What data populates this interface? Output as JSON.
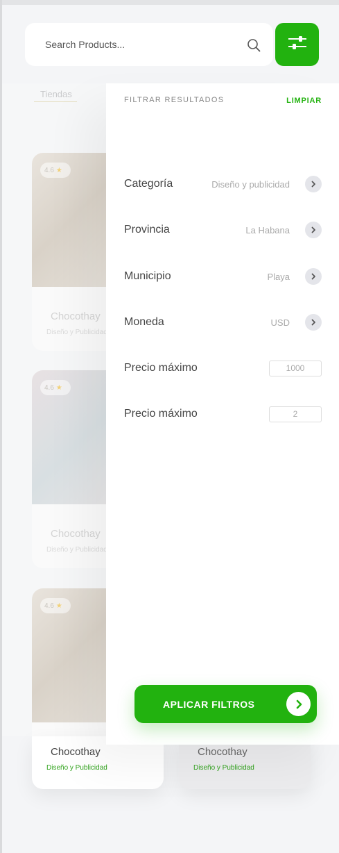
{
  "search": {
    "placeholder": "Search Products..."
  },
  "tabs": {
    "active_label": "Tiendas"
  },
  "cards": [
    {
      "rating": "4.6",
      "title": "Chocothay",
      "category": "Diseño y Publicidad"
    },
    {
      "rating": "4.6",
      "title": "Chocothay",
      "category": "Diseño y Publicidad"
    },
    {
      "rating": "4.6",
      "title": "Chocothay",
      "category": "Diseño y Publicidad"
    }
  ],
  "bottom_cards": [
    {
      "title": "Chocothay",
      "category": "Diseño y Publicidad"
    },
    {
      "title": "Chocothay",
      "category": "Diseño y Publicidad"
    }
  ],
  "filter_panel": {
    "heading": "FILTRAR RESULTADOS",
    "clear_label": "LIMPIAR",
    "rows": [
      {
        "label": "Categoría",
        "value": "Diseño y publicidad"
      },
      {
        "label": "Provincia",
        "value": "La Habana"
      },
      {
        "label": "Municipio",
        "value": "Playa"
      },
      {
        "label": "Moneda",
        "value": "USD"
      }
    ],
    "price_rows": [
      {
        "label": "Precio máximo",
        "value": "1000"
      },
      {
        "label": "Precio máximo",
        "value": "2"
      }
    ],
    "apply_label": "APLICAR FILTROS"
  },
  "colors": {
    "accent": "#22b20f",
    "category_text": "#33a41f"
  }
}
